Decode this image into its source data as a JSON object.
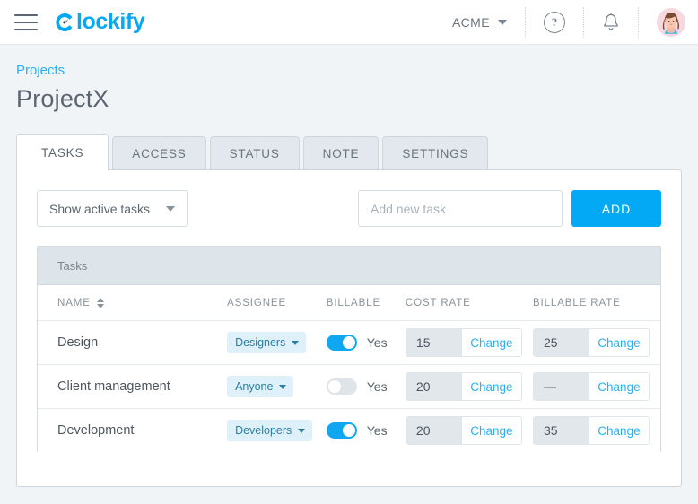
{
  "header": {
    "menu_icon": "hamburger-icon",
    "brand": "lockify",
    "brand_mark": "clockify-logo-icon",
    "workspace": "ACME",
    "help_icon": "question-mark-icon",
    "help_glyph": "?",
    "notifications_icon": "bell-icon",
    "avatar_icon": "user-avatar"
  },
  "breadcrumb": {
    "label": "Projects"
  },
  "page": {
    "title": "ProjectX"
  },
  "tabs": [
    {
      "label": "TASKS",
      "active": true
    },
    {
      "label": "ACCESS",
      "active": false
    },
    {
      "label": "STATUS",
      "active": false
    },
    {
      "label": "NOTE",
      "active": false
    },
    {
      "label": "SETTINGS",
      "active": false
    }
  ],
  "toolbar": {
    "filter_value": "Show active tasks",
    "new_task_value": "",
    "new_task_placeholder": "Add new task",
    "add_label": "ADD"
  },
  "table": {
    "band_label": "Tasks",
    "columns": {
      "name": "NAME",
      "assignee": "ASSIGNEE",
      "billable": "BILLABLE",
      "cost_rate": "COST RATE",
      "billable_rate": "BILLABLE RATE"
    },
    "change_label": "Change",
    "rows": [
      {
        "name": "Design",
        "assignee": "Designers",
        "billable": true,
        "billable_label": "Yes",
        "cost_rate": "15",
        "billable_rate": "25"
      },
      {
        "name": "Client management",
        "assignee": "Anyone",
        "billable": false,
        "billable_label": "Yes",
        "cost_rate": "20",
        "billable_rate": "—"
      },
      {
        "name": "Development",
        "assignee": "Developers",
        "billable": true,
        "billable_label": "Yes",
        "cost_rate": "20",
        "billable_rate": "35"
      }
    ]
  },
  "colors": {
    "accent": "#03a9f4",
    "link": "#2ab0f4",
    "page_bg": "#f1f4f7",
    "band_bg": "#dde4ea",
    "pill_bg": "#def0fa",
    "pill_text": "#2c7ea1"
  }
}
